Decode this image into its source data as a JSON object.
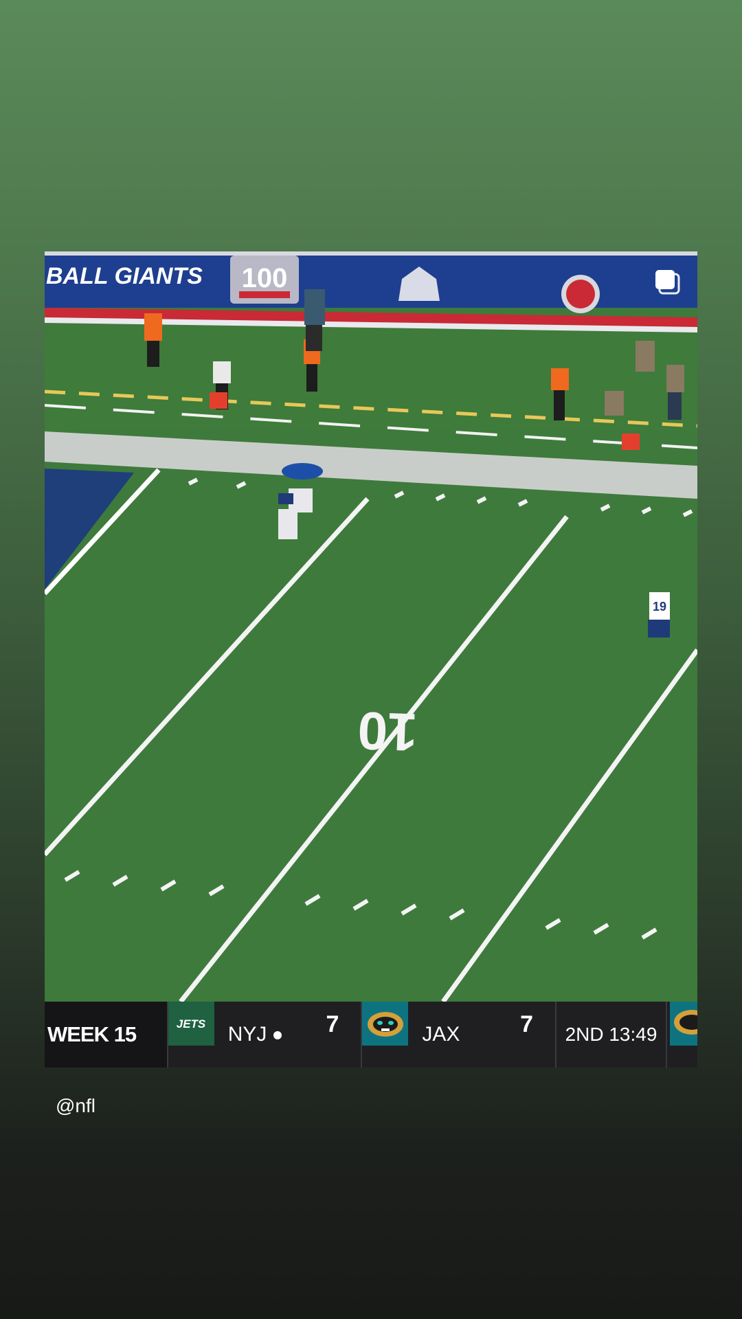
{
  "post": {
    "banner_text": "BALL GIANTS",
    "anniversary_badge": "100",
    "yard_number": "10",
    "player_number": "19",
    "multi_post_icon": "stacked-squares-icon"
  },
  "scorebug": {
    "week": "WEEK 15",
    "away": {
      "logo_text": "JETS",
      "abbr": "NYJ",
      "score": "7",
      "has_possession": true,
      "color": "#1f6140"
    },
    "home": {
      "abbr": "JAX",
      "score": "7",
      "color": "#0e7380"
    },
    "clock": "2ND 13:49"
  },
  "caption": "@nfl",
  "colors": {
    "turf": "#3f7a3a",
    "wall": "#1d3f8c",
    "scorebug": "#1f1f22"
  }
}
